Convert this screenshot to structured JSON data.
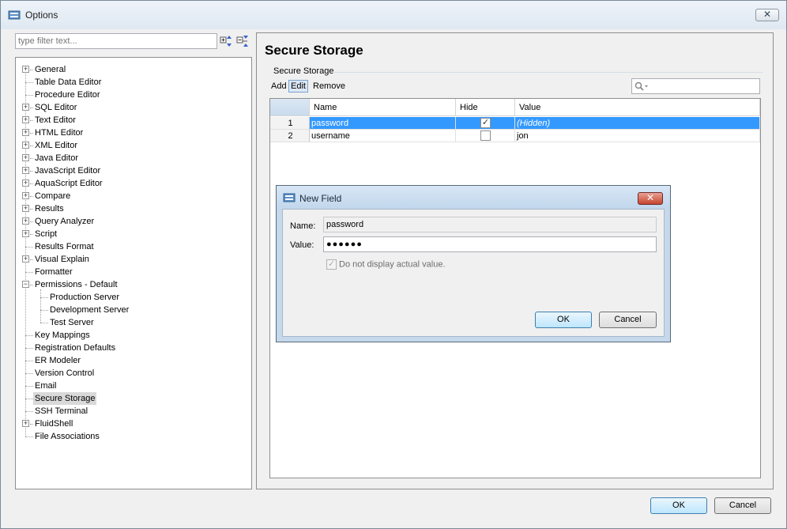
{
  "window": {
    "title": "Options",
    "close_glyph": "✕"
  },
  "filter": {
    "placeholder": "type filter text..."
  },
  "tree": {
    "items": [
      {
        "label": "General",
        "expander": "+",
        "level": 0
      },
      {
        "label": "Table Data Editor",
        "expander": "",
        "level": 0
      },
      {
        "label": "Procedure Editor",
        "expander": "",
        "level": 0
      },
      {
        "label": "SQL Editor",
        "expander": "+",
        "level": 0
      },
      {
        "label": "Text Editor",
        "expander": "+",
        "level": 0
      },
      {
        "label": "HTML Editor",
        "expander": "+",
        "level": 0
      },
      {
        "label": "XML Editor",
        "expander": "+",
        "level": 0
      },
      {
        "label": "Java Editor",
        "expander": "+",
        "level": 0
      },
      {
        "label": "JavaScript Editor",
        "expander": "+",
        "level": 0
      },
      {
        "label": "AquaScript Editor",
        "expander": "+",
        "level": 0
      },
      {
        "label": "Compare",
        "expander": "+",
        "level": 0
      },
      {
        "label": "Results",
        "expander": "+",
        "level": 0
      },
      {
        "label": "Query Analyzer",
        "expander": "+",
        "level": 0
      },
      {
        "label": "Script",
        "expander": "+",
        "level": 0
      },
      {
        "label": "Results Format",
        "expander": "",
        "level": 0
      },
      {
        "label": "Visual Explain",
        "expander": "+",
        "level": 0
      },
      {
        "label": "Formatter",
        "expander": "",
        "level": 0
      },
      {
        "label": "Permissions - Default",
        "expander": "−",
        "level": 0
      },
      {
        "label": "Production Server",
        "expander": "",
        "level": 1
      },
      {
        "label": "Development Server",
        "expander": "",
        "level": 1
      },
      {
        "label": "Test Server",
        "expander": "",
        "level": 1
      },
      {
        "label": "Key Mappings",
        "expander": "",
        "level": 0
      },
      {
        "label": "Registration Defaults",
        "expander": "",
        "level": 0
      },
      {
        "label": "ER Modeler",
        "expander": "",
        "level": 0
      },
      {
        "label": "Version Control",
        "expander": "",
        "level": 0
      },
      {
        "label": "Email",
        "expander": "",
        "level": 0
      },
      {
        "label": "Secure Storage",
        "expander": "",
        "level": 0,
        "selected": true
      },
      {
        "label": "SSH Terminal",
        "expander": "",
        "level": 0
      },
      {
        "label": "FluidShell",
        "expander": "+",
        "level": 0
      },
      {
        "label": "File Associations",
        "expander": "",
        "level": 0
      }
    ]
  },
  "main": {
    "page_title": "Secure Storage",
    "group_label": "Secure Storage",
    "toolbar": {
      "add": "Add",
      "edit": "Edit",
      "remove": "Remove"
    },
    "table": {
      "columns": [
        "Name",
        "Hide",
        "Value"
      ],
      "rows": [
        {
          "num": "1",
          "name": "password",
          "hide": true,
          "value": "(Hidden)",
          "selected": true
        },
        {
          "num": "2",
          "name": "username",
          "hide": false,
          "value": "jon",
          "selected": false
        }
      ]
    }
  },
  "dialog": {
    "title": "New Field",
    "close_glyph": "✕",
    "name_label": "Name:",
    "name_value": "password",
    "value_label": "Value:",
    "value_value": "●●●●●●",
    "checkbox_label": "Do not display actual value.",
    "checkbox_checked": true,
    "ok_label": "OK",
    "cancel_label": "Cancel"
  },
  "footer": {
    "ok_label": "OK",
    "cancel_label": "Cancel"
  },
  "colors": {
    "selection": "#3399ff",
    "hidden_text": "#ffffff"
  }
}
